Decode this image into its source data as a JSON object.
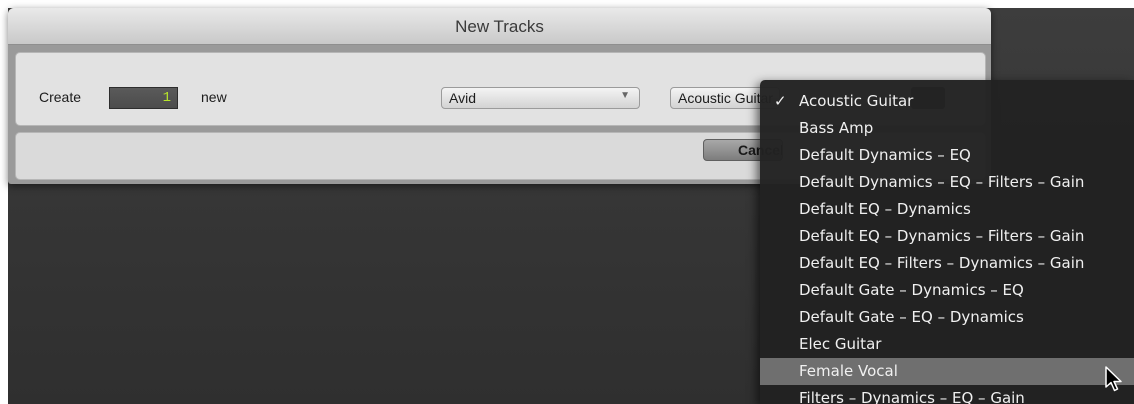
{
  "dialog": {
    "title": "New Tracks",
    "create_label": "Create",
    "count_value": "1",
    "new_label": "new",
    "preset_category": "Avid",
    "preset_selected": "Acoustic Guitar",
    "cancel_label": "Cancel"
  },
  "preset_menu": {
    "items": [
      {
        "label": "Acoustic Guitar",
        "checked": true
      },
      {
        "label": "Bass Amp"
      },
      {
        "label": "Default Dynamics – EQ"
      },
      {
        "label": "Default Dynamics – EQ – Filters – Gain"
      },
      {
        "label": "Default EQ – Dynamics"
      },
      {
        "label": "Default EQ – Dynamics – Filters – Gain"
      },
      {
        "label": "Default EQ – Filters – Dynamics – Gain"
      },
      {
        "label": "Default Gate – Dynamics – EQ"
      },
      {
        "label": "Default Gate – EQ – Dynamics"
      },
      {
        "label": "Elec Guitar"
      },
      {
        "label": "Female Vocal",
        "highlighted": true
      },
      {
        "label": "Filters – Dynamics – EQ – Gain"
      }
    ],
    "check_glyph": "✓",
    "highlight_color": "#6f6f6f"
  },
  "icons": {
    "popup_arrow": "chevron-down-icon",
    "cursor": "mouse-pointer-icon"
  },
  "colors": {
    "counter_text": "#b8e62a",
    "menu_background": "#222222"
  }
}
